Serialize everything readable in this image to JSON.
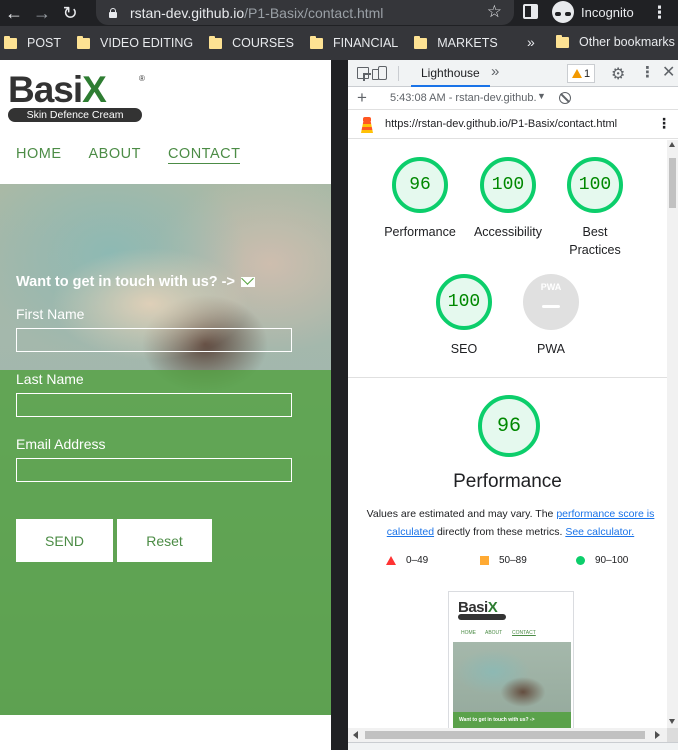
{
  "browser": {
    "url_host": "rstan-dev.github.io",
    "url_path": "/P1-Basix/contact.html",
    "profile_label": "Incognito",
    "bookmarks": [
      "POST",
      "VIDEO EDITING",
      "COURSES",
      "FINANCIAL",
      "MARKETS"
    ],
    "overflow_label": "»",
    "other_bookmarks": "Other bookmarks"
  },
  "site": {
    "logo_text": "Basi",
    "logo_x": "X",
    "logo_reg": "®",
    "logo_tagline": "Skin Defence Cream",
    "nav": {
      "home": "HOME",
      "about": "ABOUT",
      "contact": "CONTACT"
    },
    "form": {
      "title": "Want to get in touch with us? ->",
      "first_name_label": "First Name",
      "first_name_value": "",
      "last_name_label": "Last Name",
      "last_name_value": "",
      "email_label": "Email Address",
      "email_value": "",
      "send_label": "SEND",
      "reset_label": "Reset"
    }
  },
  "devtools": {
    "active_tab": "Lighthouse",
    "more_tabs": "»",
    "warning_count": "1",
    "report_label": "5:43:08 AM - rstan-dev.github.",
    "audited_url": "https://rstan-dev.github.io/P1-Basix/contact.html",
    "scores": {
      "performance": {
        "label": "Performance",
        "value": "96"
      },
      "accessibility": {
        "label": "Accessibility",
        "value": "100"
      },
      "best_practices": {
        "label": "Best\nPractices",
        "value": "100"
      },
      "seo": {
        "label": "SEO",
        "value": "100"
      },
      "pwa": {
        "label": "PWA",
        "badge": "PWA"
      }
    },
    "performance_section": {
      "score": "96",
      "title": "Performance",
      "note_prefix": "Values are estimated and may vary. The ",
      "note_link1": "performance score is calculated",
      "note_middle": " directly from these metrics. ",
      "note_link2": "See calculator."
    },
    "legend": {
      "fail": "0–49",
      "average": "50–89",
      "pass": "90–100"
    },
    "thumbnail": {
      "logo_text": "Basi",
      "logo_x": "X",
      "nav_home": "HOME",
      "nav_about": "ABOUT",
      "nav_contact": "CONTACT",
      "form_title": "Want to get in touch with us? ->"
    },
    "colors": {
      "pass": "#0cce6b",
      "average": "#ffaa33",
      "fail": "#ff3333",
      "link": "#1a73e8"
    }
  }
}
